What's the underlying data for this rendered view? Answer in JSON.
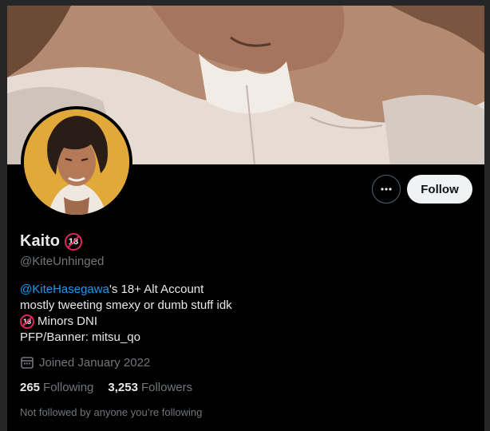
{
  "profile": {
    "name": "Kaito",
    "handle": "@KiteUnhinged",
    "badge_text": "18",
    "bio": {
      "mention": "@KiteHasegawa",
      "line1_rest": "'s 18+ Alt Account",
      "line2": "mostly tweeting smexy or dumb stuff idk",
      "line3": "Minors DNI",
      "line4": "PFP/Banner: mitsu_qo"
    },
    "joined": "Joined January 2022",
    "following_count": "265",
    "following_label": "Following",
    "followers_count": "3,253",
    "followers_label": "Followers",
    "followed_by_note": "Not followed by anyone you’re following"
  },
  "actions": {
    "more_icon": "more-horizontal-icon",
    "follow_label": "Follow"
  },
  "colors": {
    "background": "#000000",
    "accent_link": "#1d9bf0",
    "muted_text": "#71767b",
    "follow_button_bg": "#eff3f4",
    "avatar_bg": "#e0a93a"
  }
}
